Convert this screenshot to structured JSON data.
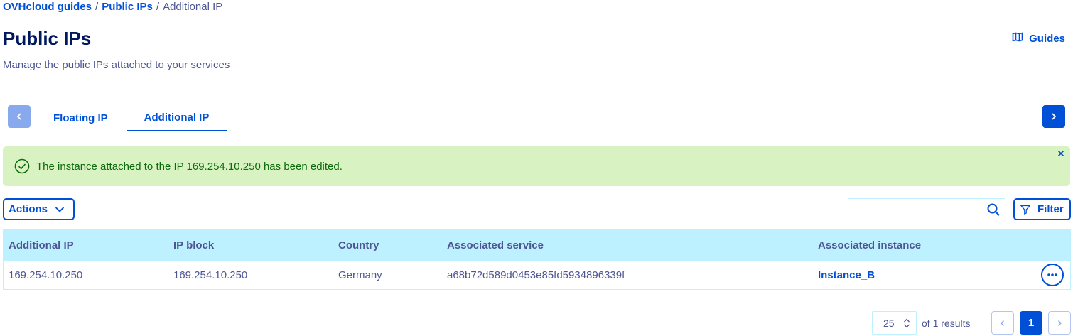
{
  "breadcrumb": {
    "items": [
      "OVHcloud guides",
      "Public IPs",
      "Additional IP"
    ],
    "separator": "/"
  },
  "header": {
    "title": "Public IPs",
    "subtitle": "Manage the public IPs attached to your services",
    "guides_label": "Guides",
    "guides_icon": "book-icon"
  },
  "tabs": [
    {
      "label": "Floating IP",
      "active": false
    },
    {
      "label": "Additional IP",
      "active": true
    }
  ],
  "alert": {
    "message": "The instance attached to the IP 169.254.10.250 has been edited.",
    "type": "success",
    "color": "#d9f2c2"
  },
  "toolbar": {
    "actions_label": "Actions",
    "search_placeholder": "",
    "search_value": "",
    "filter_label": "Filter"
  },
  "table": {
    "columns": [
      "Additional IP",
      "IP block",
      "Country",
      "Associated service",
      "Associated instance"
    ],
    "rows": [
      {
        "additional_ip": "169.254.10.250",
        "ip_block": "169.254.10.250",
        "country": "Germany",
        "associated_service": "a68b72d589d0453e85fd5934896339f",
        "associated_instance": "Instance_B"
      }
    ]
  },
  "pagination": {
    "page_size": "25",
    "results_text": "of 1 results",
    "current_page": "1"
  },
  "colors": {
    "primary": "#0050d7",
    "heading": "#00185e",
    "text": "#4d5693",
    "table_header": "#bef1ff",
    "success_bg": "#d9f2c2",
    "success_text": "#0c6a0c"
  }
}
